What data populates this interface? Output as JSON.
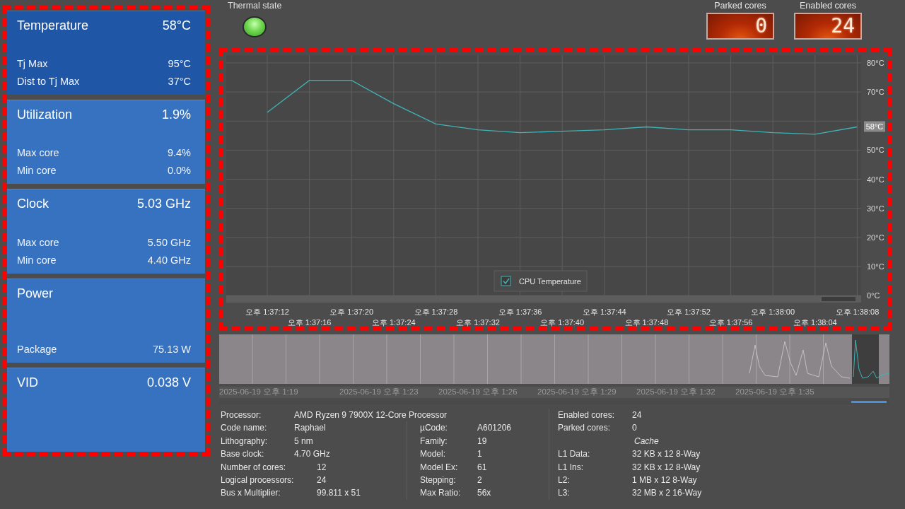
{
  "sidebar": {
    "highlighted": true,
    "cards": [
      {
        "title": "Temperature",
        "value": "58°C",
        "selected": true,
        "rows": [
          {
            "label": "Tj Max",
            "value": "95°C"
          },
          {
            "label": "Dist to Tj Max",
            "value": "37°C"
          }
        ]
      },
      {
        "title": "Utilization",
        "value": "1.9%",
        "selected": false,
        "rows": [
          {
            "label": "Max core",
            "value": "9.4%"
          },
          {
            "label": "Min core",
            "value": "0.0%"
          }
        ]
      },
      {
        "title": "Clock",
        "value": "5.03 GHz",
        "selected": false,
        "rows": [
          {
            "label": "Max core",
            "value": "5.50 GHz"
          },
          {
            "label": "Min core",
            "value": "4.40 GHz"
          }
        ]
      },
      {
        "title": "Power",
        "selected": false,
        "rows": [
          {
            "label": "Package",
            "value": "75.13 W"
          }
        ]
      },
      {
        "title": "VID",
        "value": "0.038 V",
        "selected": false
      }
    ]
  },
  "thermal_state": {
    "label": "Thermal state",
    "warning": false
  },
  "counters": [
    {
      "label": "Parked cores",
      "value": "0"
    },
    {
      "label": "Enabled cores",
      "value": "24"
    }
  ],
  "chart": {
    "highlighted": true,
    "legend_checked": true,
    "current_reading": "58°C",
    "chart_data": {
      "type": "line",
      "x": [
        "오후 1:37:12",
        "오후 1:37:16",
        "오후 1:37:20",
        "오후 1:37:24",
        "오후 1:37:28",
        "오후 1:37:32",
        "오후 1:37:36",
        "오후 1:37:40",
        "오후 1:37:44",
        "오후 1:37:48",
        "오후 1:37:52",
        "오후 1:37:56",
        "오후 1:38:00",
        "오후 1:38:04",
        "오후 1:38:08"
      ],
      "series": [
        {
          "name": "CPU Temperature",
          "color": "#3fb3b5",
          "values": [
            63,
            74,
            74,
            66,
            59,
            57,
            56,
            56.5,
            57,
            58,
            57,
            57,
            56,
            55.5,
            58
          ]
        }
      ],
      "ylim": [
        0,
        80
      ],
      "grid": true,
      "yticks": [
        {
          "value": 0,
          "label": "0°C"
        },
        {
          "value": 10,
          "label": "10°C"
        },
        {
          "value": 20,
          "label": "20°C"
        },
        {
          "value": 30,
          "label": "30°C"
        },
        {
          "value": 40,
          "label": "40°C"
        },
        {
          "value": 50,
          "label": "50°C"
        },
        {
          "value": 70,
          "label": "70°C"
        },
        {
          "value": 80,
          "label": "80°C"
        }
      ]
    }
  },
  "overview": {
    "labels": [
      "2025-06-19 오후 1:19",
      "2025-06-19 오후 1:23",
      "2025-06-19 오후 1:26",
      "2025-06-19 오후 1:29",
      "2025-06-19 오후 1:32",
      "2025-06-19 오후 1:35"
    ]
  },
  "info": {
    "processor": [
      {
        "label": "Processor:",
        "value": "AMD Ryzen 9 7900X 12-Core Processor"
      },
      {
        "label": "Code name:",
        "value": "Raphael"
      },
      {
        "label": "Lithography:",
        "value": "5 nm"
      },
      {
        "label": "Base clock:",
        "value": "4.70 GHz"
      }
    ],
    "topology": [
      {
        "label": "Number of cores:",
        "value": "12"
      },
      {
        "label": "Logical processors:",
        "value": "24"
      },
      {
        "label": "Bus x Multiplier:",
        "value": "99.811 x 51"
      }
    ],
    "cpuid": [
      {
        "label": "µCode:",
        "value": "A601206"
      },
      {
        "label": "Family:",
        "value": "19"
      },
      {
        "label": "Model:",
        "value": "1"
      },
      {
        "label": "Model Ex:",
        "value": "61"
      },
      {
        "label": "Stepping:",
        "value": "2"
      },
      {
        "label": "Max Ratio:",
        "value": "56x"
      }
    ],
    "cores": [
      {
        "label": "Enabled cores:",
        "value": "24"
      },
      {
        "label": "Parked cores:",
        "value": "0"
      }
    ],
    "cache_title": "Cache",
    "cache": [
      {
        "label": "L1 Data:",
        "value": "32 KB x 12  8-Way"
      },
      {
        "label": "L1 Ins:",
        "value": "32 KB x 12  8-Way"
      },
      {
        "label": "L2:",
        "value": "1 MB x 12  8-Way"
      },
      {
        "label": "L3:",
        "value": "32 MB x 2  16-Way"
      }
    ]
  }
}
